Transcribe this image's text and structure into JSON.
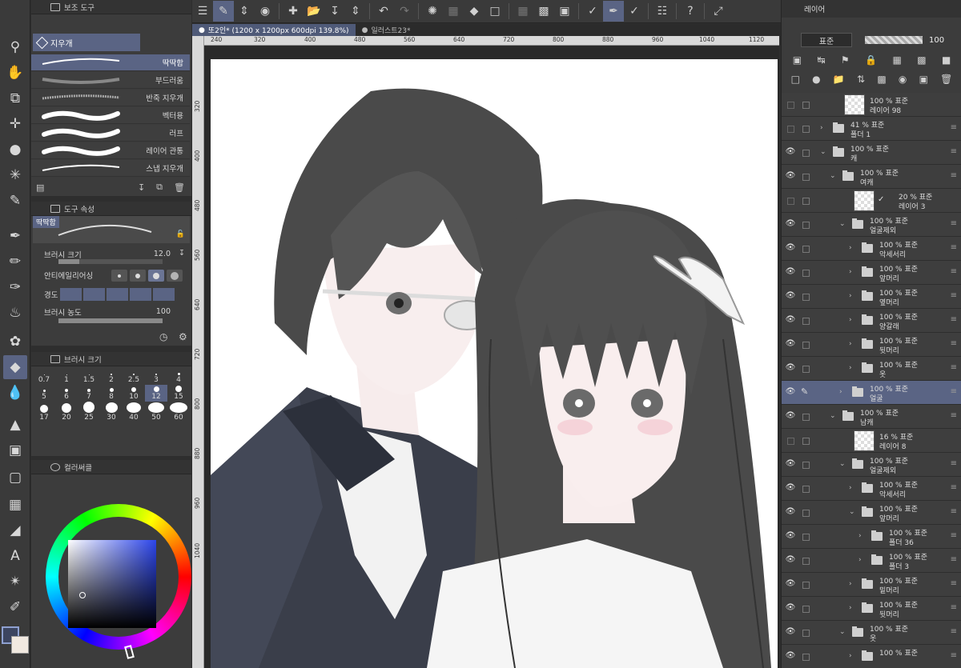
{
  "subtool_panel": {
    "title": "보조 도구",
    "group": "지우개",
    "items": [
      {
        "label": "딱딱함",
        "selected": true
      },
      {
        "label": "부드러움",
        "selected": false
      },
      {
        "label": "반죽 지우개",
        "selected": false
      },
      {
        "label": "벡터용",
        "selected": false
      },
      {
        "label": "러프",
        "selected": false
      },
      {
        "label": "레이어 관통",
        "selected": false
      },
      {
        "label": "스냅 지우개",
        "selected": false
      }
    ]
  },
  "tool_property": {
    "title": "도구 속성",
    "preset": "딱딱함",
    "brush_size_label": "브러시 크기",
    "brush_size_value": "12.0",
    "antialias_label": "안티에일리어싱",
    "hardness_label": "경도",
    "density_label": "브러시 농도",
    "density_value": "100"
  },
  "brush_size_panel": {
    "title": "브러시 크기",
    "rows": [
      [
        "0.7",
        "1",
        "1.5",
        "2",
        "2.5",
        "3",
        "4"
      ],
      [
        "5",
        "6",
        "7",
        "8",
        "10",
        "12",
        "15"
      ],
      [
        "17",
        "20",
        "25",
        "30",
        "40",
        "50",
        "60"
      ]
    ],
    "selected": "12"
  },
  "color_panel": {
    "title": "컬러써클",
    "main_color": "#3c4560",
    "sub_color": "#f1e9e0"
  },
  "canvas_tabs": [
    {
      "label": "또2인* (1200 x 1200px 600dpi 139.8%)",
      "active": true
    },
    {
      "label": "일러스트23*",
      "active": false
    }
  ],
  "ruler_top": [
    "240",
    "320",
    "400",
    "480",
    "560",
    "640",
    "720",
    "800",
    "880",
    "960",
    "1040",
    "1120"
  ],
  "ruler_left": [
    "320",
    "400",
    "480",
    "560",
    "640",
    "720",
    "800",
    "880",
    "960",
    "1040"
  ],
  "layer_panel": {
    "title": "레이어",
    "blend_mode": "표준",
    "opacity": "100",
    "layers": [
      {
        "name": "레이어 98",
        "meta": "100 % 표준",
        "indent": 0,
        "kind": "layer",
        "visible": false
      },
      {
        "name": "폴더 1",
        "meta": "41 % 표준",
        "indent": 0,
        "kind": "folder",
        "expanded": false,
        "visible": false
      },
      {
        "name": "캐",
        "meta": "100 % 표준",
        "indent": 0,
        "kind": "folder",
        "expanded": true,
        "visible": true
      },
      {
        "name": "여캐",
        "meta": "100 % 표준",
        "indent": 1,
        "kind": "folder",
        "expanded": true,
        "visible": true
      },
      {
        "name": "레이어 3",
        "meta": "20 % 표준",
        "indent": 1,
        "kind": "layer",
        "visible": false,
        "check": true
      },
      {
        "name": "얼굴제외",
        "meta": "100 % 표준",
        "indent": 2,
        "kind": "folder",
        "expanded": true,
        "visible": true
      },
      {
        "name": "악세서리",
        "meta": "100 % 표준",
        "indent": 3,
        "kind": "folder",
        "expanded": false,
        "visible": true
      },
      {
        "name": "앞머리",
        "meta": "100 % 표준",
        "indent": 3,
        "kind": "folder",
        "expanded": false,
        "visible": true
      },
      {
        "name": "옆머리",
        "meta": "100 % 표준",
        "indent": 3,
        "kind": "folder",
        "expanded": false,
        "visible": true
      },
      {
        "name": "양갈래",
        "meta": "100 % 표준",
        "indent": 3,
        "kind": "folder",
        "expanded": false,
        "visible": true
      },
      {
        "name": "뒷머리",
        "meta": "100 % 표준",
        "indent": 3,
        "kind": "folder",
        "expanded": false,
        "visible": true
      },
      {
        "name": "옷",
        "meta": "100 % 표준",
        "indent": 3,
        "kind": "folder",
        "expanded": false,
        "visible": true
      },
      {
        "name": "얼굴",
        "meta": "100 % 표준",
        "indent": 2,
        "kind": "folder",
        "expanded": false,
        "visible": true,
        "selected": true
      },
      {
        "name": "남캐",
        "meta": "100 % 표준",
        "indent": 1,
        "kind": "folder",
        "expanded": true,
        "visible": true
      },
      {
        "name": "레이어 8",
        "meta": "16 % 표준",
        "indent": 1,
        "kind": "layer",
        "visible": false
      },
      {
        "name": "얼굴제외",
        "meta": "100 % 표준",
        "indent": 2,
        "kind": "folder",
        "expanded": true,
        "visible": true
      },
      {
        "name": "악세서리",
        "meta": "100 % 표준",
        "indent": 3,
        "kind": "folder",
        "expanded": false,
        "visible": true
      },
      {
        "name": "앞머리",
        "meta": "100 % 표준",
        "indent": 3,
        "kind": "folder",
        "expanded": true,
        "visible": true
      },
      {
        "name": "폴더 36",
        "meta": "100 % 표준",
        "indent": 4,
        "kind": "folder",
        "expanded": false,
        "visible": true
      },
      {
        "name": "폴더 3",
        "meta": "100 % 표준",
        "indent": 4,
        "kind": "folder",
        "expanded": false,
        "visible": true
      },
      {
        "name": "밑머리",
        "meta": "100 % 표준",
        "indent": 3,
        "kind": "folder",
        "expanded": false,
        "visible": true
      },
      {
        "name": "뒷머리",
        "meta": "100 % 표준",
        "indent": 3,
        "kind": "folder",
        "expanded": false,
        "visible": true
      },
      {
        "name": "옷",
        "meta": "100 % 표준",
        "indent": 2,
        "kind": "folder",
        "expanded": true,
        "visible": true
      },
      {
        "name": "",
        "meta": "100 % 표준",
        "indent": 3,
        "kind": "folder",
        "expanded": false,
        "visible": true
      }
    ]
  }
}
